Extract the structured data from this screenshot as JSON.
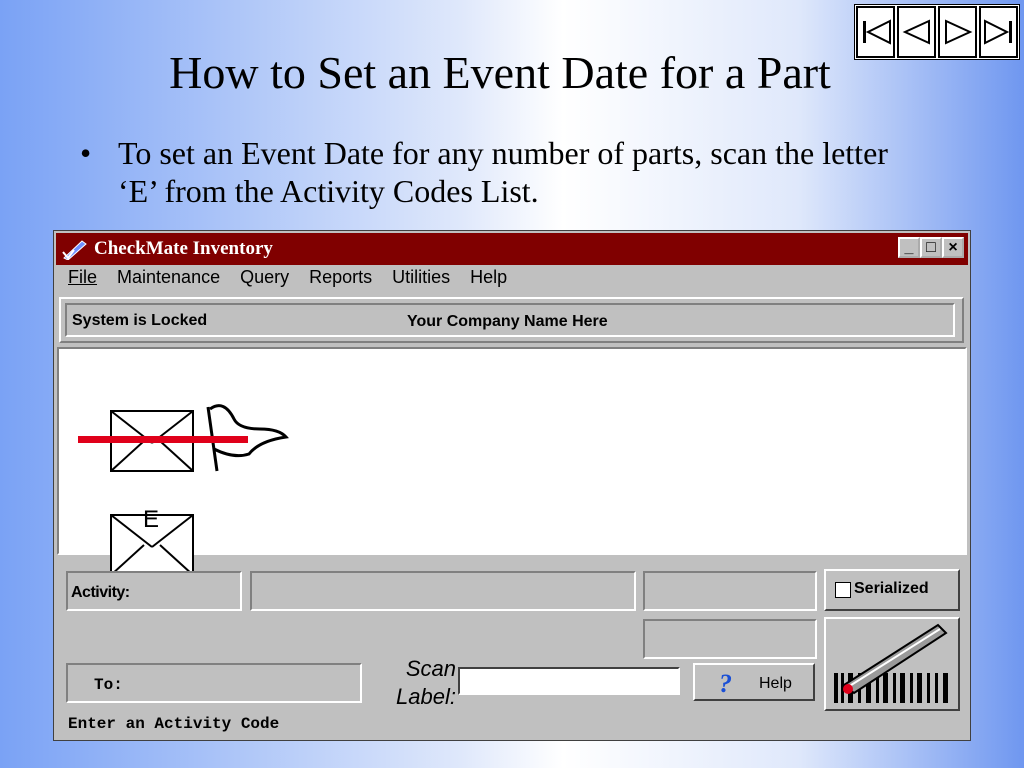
{
  "slide": {
    "title": "How to Set an Event Date for a Part",
    "bullet_marker": "•",
    "bullet": "To set an Event Date for any number of parts, scan the letter ‘E’ from the Activity Codes List."
  },
  "nav": [
    "first-slide-icon",
    "previous-slide-icon",
    "next-slide-icon",
    "last-slide-icon"
  ],
  "window": {
    "title": "CheckMate Inventory",
    "controls": {
      "minimize": "_",
      "maximize": "□",
      "close": "×"
    },
    "menu": [
      "File",
      "Maintenance",
      "Query",
      "Reports",
      "Utilities",
      "Help"
    ],
    "status_left": "System is Locked",
    "status_center": "Your Company Name Here",
    "envelope_letter": "E",
    "activity_label": "Activity:",
    "serialized_label": "Serialized",
    "to_label": "To:",
    "scan_label_line1": "Scan",
    "scan_label_line2": "Label:",
    "scan_value": "",
    "help_label": "Help",
    "help_glyph": "?",
    "status_message": "Enter an Activity Code"
  },
  "colors": {
    "titlebar": "#800000",
    "redline": "#e0001a",
    "help_icon": "#1a4fd6"
  }
}
